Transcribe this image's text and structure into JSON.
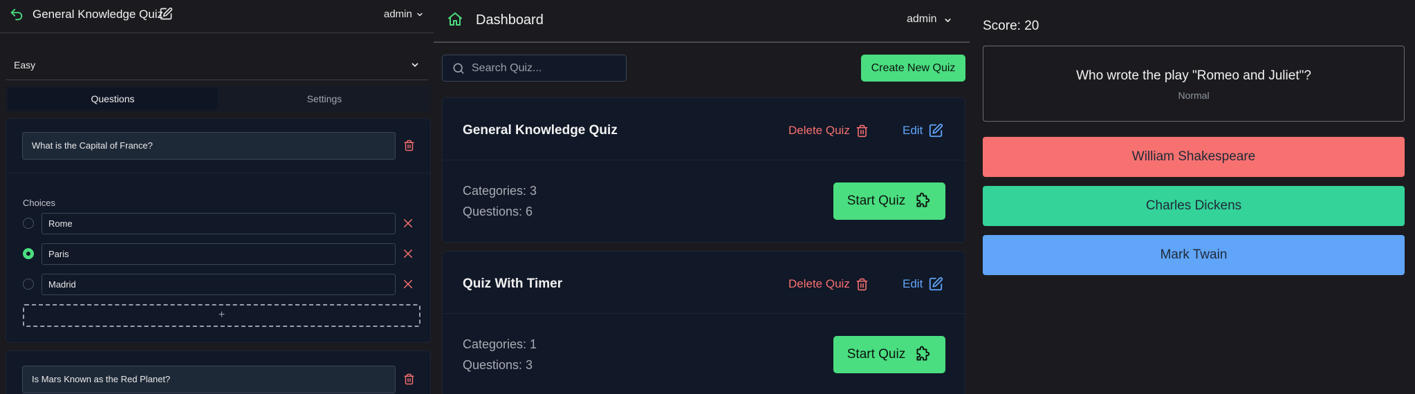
{
  "colors": {
    "accent_green": "#4ade80",
    "danger_red": "#f87171",
    "link_blue": "#60a5fa",
    "answer_red": "#f87171",
    "answer_green": "#34d399",
    "answer_blue": "#60a5fa"
  },
  "editor": {
    "header": {
      "title": "General Knowledge Quiz",
      "user": "admin",
      "icons": [
        "undo-icon",
        "pencil-square-icon",
        "chevron-down-icon"
      ]
    },
    "difficulty": "Easy",
    "tabs": [
      "Questions",
      "Settings"
    ],
    "active_tab": "Questions",
    "questions": [
      {
        "text": "What is the Capital of France?",
        "choices_label": "Choices",
        "choices": [
          {
            "label": "Rome",
            "selected": false
          },
          {
            "label": "Paris",
            "selected": true
          },
          {
            "label": "Madrid",
            "selected": false
          }
        ],
        "add_choice": "+"
      },
      {
        "text": "Is Mars Known as the Red Planet?"
      }
    ]
  },
  "dashboard": {
    "header": {
      "title": "Dashboard",
      "user": "admin",
      "icons": [
        "home-icon",
        "chevron-down-icon"
      ]
    },
    "search": {
      "placeholder": "Search Quiz..."
    },
    "create_label": "Create New Quiz",
    "quizzes": [
      {
        "name": "General Knowledge Quiz",
        "delete_label": "Delete Quiz",
        "edit_label": "Edit",
        "categories": "Categories: 3",
        "questions": "Questions: 6",
        "start_label": "Start Quiz"
      },
      {
        "name": "Quiz With Timer",
        "delete_label": "Delete Quiz",
        "edit_label": "Edit",
        "categories": "Categories: 1",
        "questions": "Questions: 3",
        "start_label": "Start Quiz"
      }
    ]
  },
  "play": {
    "score": "Score: 20",
    "question": "Who wrote the play \"Romeo and Juliet\"?",
    "level": "Normal",
    "answers": [
      "William Shakespeare",
      "Charles Dickens",
      "Mark Twain"
    ]
  }
}
